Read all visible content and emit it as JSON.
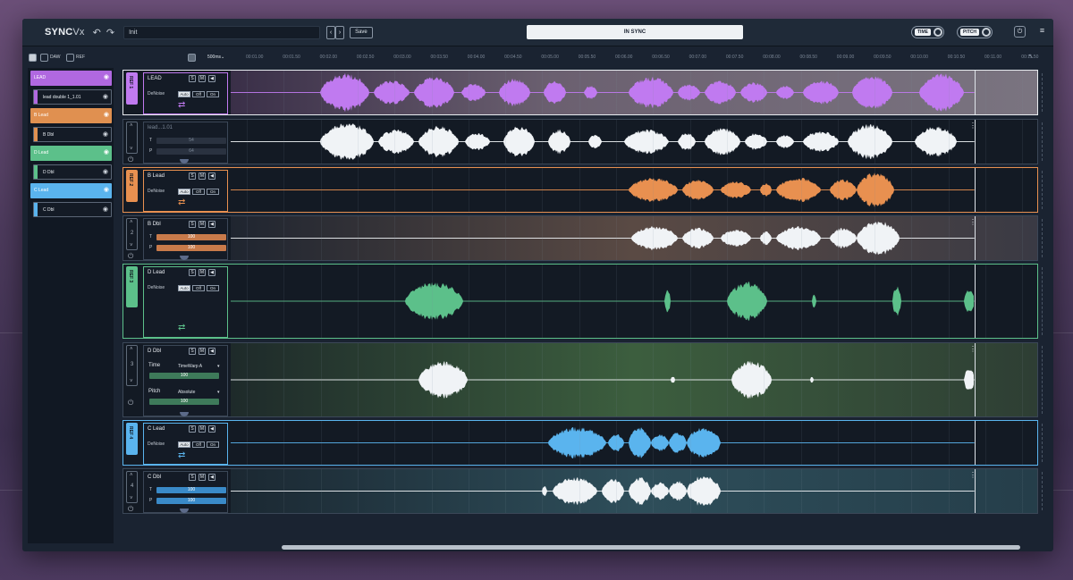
{
  "app": {
    "logo_main": "SYNC",
    "logo_suffix": "Vx",
    "preset_name": "Init",
    "save_label": "Save",
    "status": "IN SYNC",
    "time_label": "TIME",
    "pitch_label": "PITCH"
  },
  "subbar": {
    "daw_label": "DAW",
    "ref_label": "REF",
    "zoom": "500ms",
    "ticks": [
      "00:01.00",
      "00:01.50",
      "00:02.00",
      "00:02.50",
      "00:03.00",
      "00:03.50",
      "00:04.00",
      "00:04.50",
      "00:05.00",
      "00:05.50",
      "00:06.00",
      "00:06.50",
      "00:07.00",
      "00:07.50",
      "00:08.00",
      "00:08.50",
      "00:09.00",
      "00:09.50",
      "00:10.00",
      "00:10.50",
      "00:11.00",
      "00:11.50"
    ]
  },
  "sidebar": {
    "items": [
      {
        "label": "LEAD",
        "type": "ref",
        "color": "#b068e0"
      },
      {
        "label": "lead double 1_1.01",
        "type": "dbl",
        "color": "#b068e0"
      },
      {
        "label": "B Lead",
        "type": "ref",
        "color": "#e09050"
      },
      {
        "label": "B Dbl",
        "type": "dbl",
        "color": "#e09050"
      },
      {
        "label": "D Lead",
        "type": "ref",
        "color": "#5cc08a"
      },
      {
        "label": "D Dbl",
        "type": "dbl",
        "color": "#5cc08a"
      },
      {
        "label": "C Lead",
        "type": "ref",
        "color": "#5ab4ee"
      },
      {
        "label": "C Dbl",
        "type": "dbl",
        "color": "#5ab4ee"
      }
    ]
  },
  "tracks": [
    {
      "name": "LEAD",
      "ref_label": "REF 1",
      "denoise": "DeNoise",
      "auto": "Auto",
      "off": "Off",
      "on": "On",
      "color": "#c07af0"
    },
    {
      "name": "lead...1.01",
      "t_label": "T",
      "t_value": "54",
      "p_label": "P",
      "p_value": "64"
    },
    {
      "name": "B Lead",
      "ref_label": "REF 2",
      "denoise": "DeNoise",
      "auto": "Auto",
      "off": "Off",
      "on": "On",
      "color": "#e89050"
    },
    {
      "name": "B Dbl",
      "num": "2",
      "t_label": "T",
      "t_value": "100",
      "p_label": "P",
      "p_value": "100",
      "color": "#e0905a"
    },
    {
      "name": "D Lead",
      "ref_label": "REF 3",
      "denoise": "DeNoise",
      "auto": "Auto",
      "off": "Off",
      "on": "On",
      "color": "#5cc08a"
    },
    {
      "name": "D Dbl",
      "num": "3",
      "time_label": "Time",
      "time_mode": "TimeWarp A",
      "time_value": "100",
      "pitch_label": "Pitch",
      "pitch_mode": "Absolute",
      "pitch_value": "100",
      "color": "#5cc08a"
    },
    {
      "name": "C Lead",
      "ref_label": "REF 4",
      "denoise": "DeNoise",
      "auto": "Auto",
      "off": "Off",
      "on": "On",
      "color": "#5ab4ee"
    },
    {
      "name": "C Dbl",
      "num": "4",
      "t_label": "T",
      "t_value": "100",
      "p_label": "P",
      "p_value": "100",
      "color": "#4a9ed8"
    }
  ],
  "common": {
    "s_label": "S",
    "m_label": "M",
    "speaker": "◀)"
  }
}
